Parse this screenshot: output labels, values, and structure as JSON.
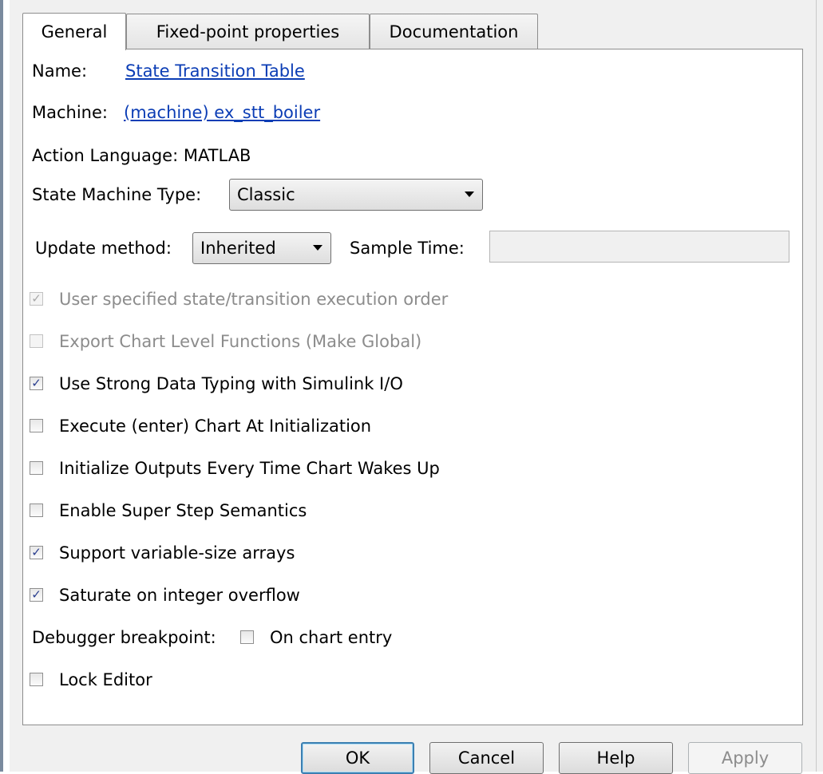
{
  "tabs": [
    {
      "label": "General",
      "active": true
    },
    {
      "label": "Fixed-point properties",
      "active": false
    },
    {
      "label": "Documentation",
      "active": false
    }
  ],
  "general": {
    "name_label": "Name:",
    "name_value": "State Transition Table",
    "machine_label": "Machine:",
    "machine_value": "(machine) ex_stt_boiler",
    "action_language": "Action Language:  MATLAB",
    "state_machine_type_label": "State Machine Type:",
    "state_machine_type_value": "Classic",
    "update_method_label": "Update method:",
    "update_method_value": "Inherited",
    "sample_time_label": "Sample Time:",
    "sample_time_value": ""
  },
  "options": [
    {
      "label": "User specified state/transition execution order",
      "checked": true,
      "enabled": false
    },
    {
      "label": "Export Chart Level Functions (Make Global)",
      "checked": false,
      "enabled": false
    },
    {
      "label": "Use Strong Data Typing with Simulink I/O",
      "checked": true,
      "enabled": true
    },
    {
      "label": "Execute (enter) Chart At Initialization",
      "checked": false,
      "enabled": true
    },
    {
      "label": "Initialize Outputs Every Time Chart Wakes Up",
      "checked": false,
      "enabled": true
    },
    {
      "label": "Enable Super Step Semantics",
      "checked": false,
      "enabled": true
    },
    {
      "label": "Support variable-size arrays",
      "checked": true,
      "enabled": true
    },
    {
      "label": "Saturate on integer overflow",
      "checked": true,
      "enabled": true
    }
  ],
  "debugger": {
    "label": "Debugger breakpoint:",
    "option_label": "On chart entry",
    "checked": false
  },
  "lock_editor": {
    "label": "Lock Editor",
    "checked": false
  },
  "buttons": {
    "ok": "OK",
    "cancel": "Cancel",
    "help": "Help",
    "apply": "Apply"
  },
  "check_glyph": "✓",
  "colors": {
    "link": "#0b3db5",
    "disabled_text": "#8c8c8c",
    "checkmark": "#2a3e8f"
  }
}
